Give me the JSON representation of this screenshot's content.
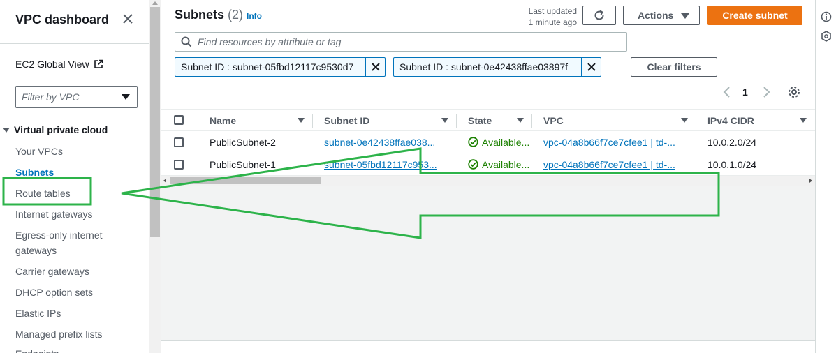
{
  "sidebar": {
    "title": "VPC dashboard",
    "ec2_global_view": "EC2 Global View",
    "filter_placeholder": "Filter by VPC",
    "section": "Virtual private cloud",
    "items": [
      {
        "label": "Your VPCs"
      },
      {
        "label": "Subnets"
      },
      {
        "label": "Route tables"
      },
      {
        "label": "Internet gateways"
      },
      {
        "label": "Egress-only internet"
      },
      {
        "label": "gateways"
      },
      {
        "label": "Carrier gateways"
      },
      {
        "label": "DHCP option sets"
      },
      {
        "label": "Elastic IPs"
      },
      {
        "label": "Managed prefix lists"
      },
      {
        "label": "Endpoints"
      }
    ],
    "active_item": "Subnets"
  },
  "header": {
    "title": "Subnets",
    "count": "(2)",
    "info": "Info",
    "last_updated_line1": "Last updated",
    "last_updated_line2": "1 minute ago",
    "actions_label": "Actions",
    "create_label": "Create subnet"
  },
  "search": {
    "placeholder": "Find resources by attribute or tag"
  },
  "filters": {
    "tokens": [
      {
        "label": "Subnet ID : subnet-05fbd12117c9530d7"
      },
      {
        "label": "Subnet ID : subnet-0e42438ffae03897f"
      }
    ],
    "clear_label": "Clear filters"
  },
  "pagination": {
    "current_page": "1"
  },
  "table": {
    "columns": [
      "Name",
      "Subnet ID",
      "State",
      "VPC",
      "IPv4 CIDR"
    ],
    "rows": [
      {
        "name": "PublicSubnet-2",
        "subnet_id": "subnet-0e42438ffae038...",
        "state": "Available...",
        "vpc": "vpc-04a8b66f7ce7cfee1 | td-...",
        "cidr": "10.0.2.0/24"
      },
      {
        "name": "PublicSubnet-1",
        "subnet_id": "subnet-05fbd12117c953...",
        "state": "Available...",
        "vpc": "vpc-04a8b66f7ce7cfee1 | td-...",
        "cidr": "10.0.1.0/24"
      }
    ]
  },
  "colors": {
    "accent": "#0073bb",
    "primary_button": "#ec7211",
    "status_ok": "#1d8102",
    "annotation": "#2db34a"
  }
}
